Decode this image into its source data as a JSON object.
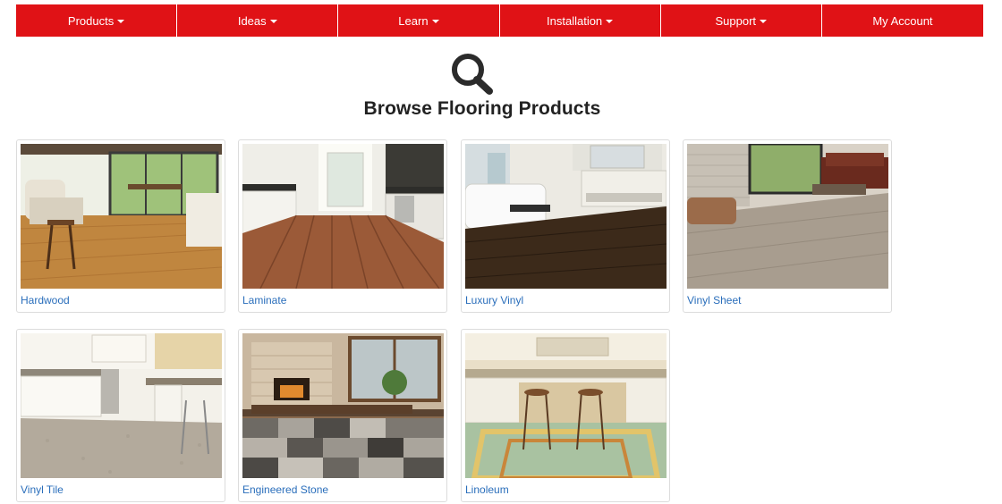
{
  "nav": {
    "items": [
      {
        "label": "Products",
        "has_dropdown": true
      },
      {
        "label": "Ideas",
        "has_dropdown": true
      },
      {
        "label": "Learn",
        "has_dropdown": true
      },
      {
        "label": "Installation",
        "has_dropdown": true
      },
      {
        "label": "Support",
        "has_dropdown": true
      },
      {
        "label": "My Account",
        "has_dropdown": false
      }
    ],
    "color": "#e01216"
  },
  "header": {
    "icon": "search-icon",
    "title": "Browse Flooring Products"
  },
  "products": [
    {
      "label": "Hardwood",
      "image": "hardwood-room-photo"
    },
    {
      "label": "Laminate",
      "image": "laminate-kitchen-photo"
    },
    {
      "label": "Luxury Vinyl",
      "image": "luxury-vinyl-bathroom-photo"
    },
    {
      "label": "Vinyl Sheet",
      "image": "vinyl-sheet-living-room-photo"
    },
    {
      "label": "Vinyl Tile",
      "image": "vinyl-tile-kitchen-photo"
    },
    {
      "label": "Engineered Stone",
      "image": "engineered-stone-dining-photo"
    },
    {
      "label": "Linoleum",
      "image": "linoleum-kitchen-photo"
    }
  ],
  "colors": {
    "link": "#2a6ebb",
    "card_border": "#dcdcdc"
  }
}
